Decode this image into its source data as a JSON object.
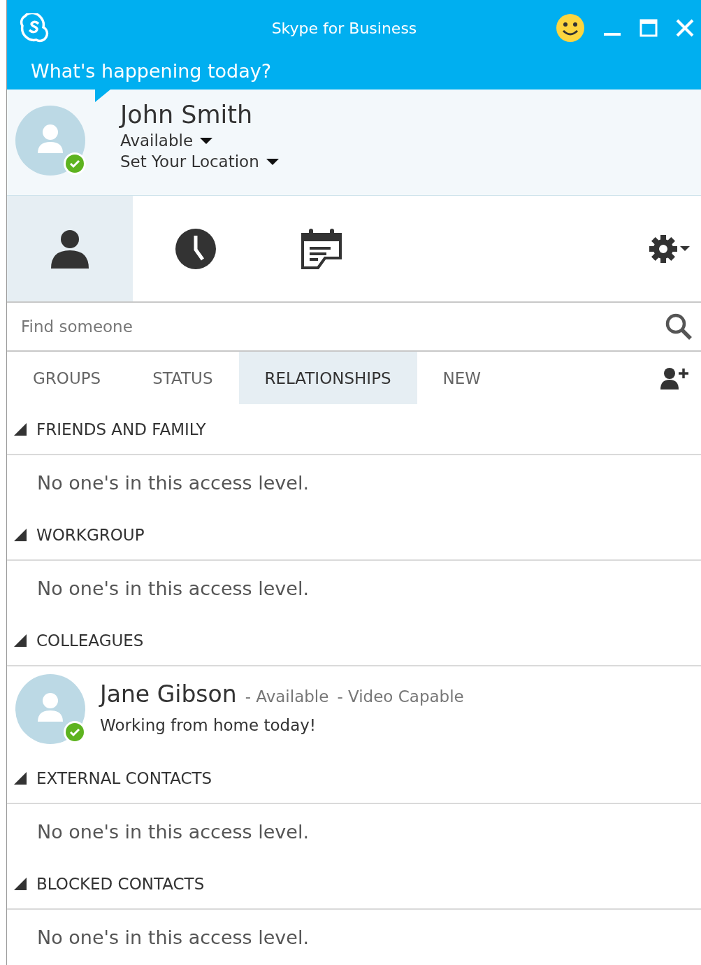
{
  "window": {
    "title": "Skype for Business"
  },
  "mood": {
    "placeholder": "What's happening today?"
  },
  "profile": {
    "name": "John Smith",
    "status": "Available",
    "location": "Set Your Location",
    "available": true
  },
  "nav_tabs": [
    {
      "kind": "contacts",
      "selected": true
    },
    {
      "kind": "history",
      "selected": false
    },
    {
      "kind": "meetings",
      "selected": false
    }
  ],
  "search": {
    "placeholder": "Find someone"
  },
  "filter_tabs": [
    {
      "label": "GROUPS",
      "selected": false
    },
    {
      "label": "STATUS",
      "selected": false
    },
    {
      "label": "RELATIONSHIPS",
      "selected": true
    },
    {
      "label": "NEW",
      "selected": false
    }
  ],
  "groups": [
    {
      "name": "FRIENDS AND FAMILY",
      "expanded": true,
      "empty_text": "No one's in this access level."
    },
    {
      "name": "WORKGROUP",
      "expanded": true,
      "empty_text": "No one's in this access level."
    },
    {
      "name": "COLLEAGUES",
      "expanded": true,
      "contacts": [
        {
          "name": "Jane Gibson",
          "status": "- Available",
          "capability": "- Video Capable",
          "note": "Working from home today!",
          "available": true
        }
      ]
    },
    {
      "name": "EXTERNAL CONTACTS",
      "expanded": true,
      "empty_text": "No one's in this access level."
    },
    {
      "name": "BLOCKED CONTACTS",
      "expanded": true,
      "empty_text": "No one's in this access level."
    }
  ]
}
